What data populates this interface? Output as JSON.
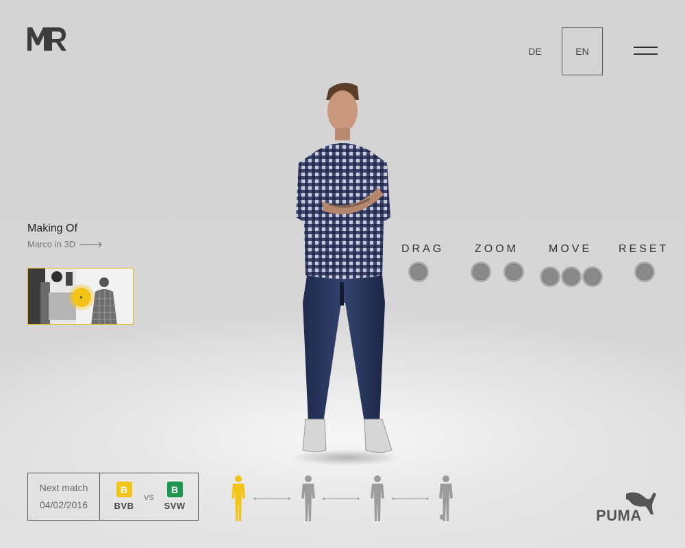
{
  "brand": {
    "logo_text": "MR"
  },
  "language": {
    "options": [
      "DE",
      "EN"
    ],
    "selected": "EN"
  },
  "making_of": {
    "title": "Making Of",
    "subtitle": "Marco in 3D"
  },
  "controls": [
    {
      "label": "DRAG",
      "dots": 1
    },
    {
      "label": "ZOOM",
      "dots": 2
    },
    {
      "label": "MOVE",
      "dots": 3
    },
    {
      "label": "RESET",
      "dots": 1
    }
  ],
  "next_match": {
    "label": "Next match",
    "date": "04/02/2016",
    "home": {
      "name": "BVB",
      "badge": "B",
      "color": "#f3c318"
    },
    "vs": "VS",
    "away": {
      "name": "SVW",
      "badge": "B",
      "color": "#1f9552"
    }
  },
  "poses": {
    "count": 4,
    "active_index": 0,
    "active_color": "#f3c318",
    "inactive_color": "#9c9c9c"
  },
  "sponsor": {
    "name": "PUMA"
  },
  "colors": {
    "accent": "#f3c318",
    "text": "#333333",
    "background": "#d6d6d6"
  }
}
